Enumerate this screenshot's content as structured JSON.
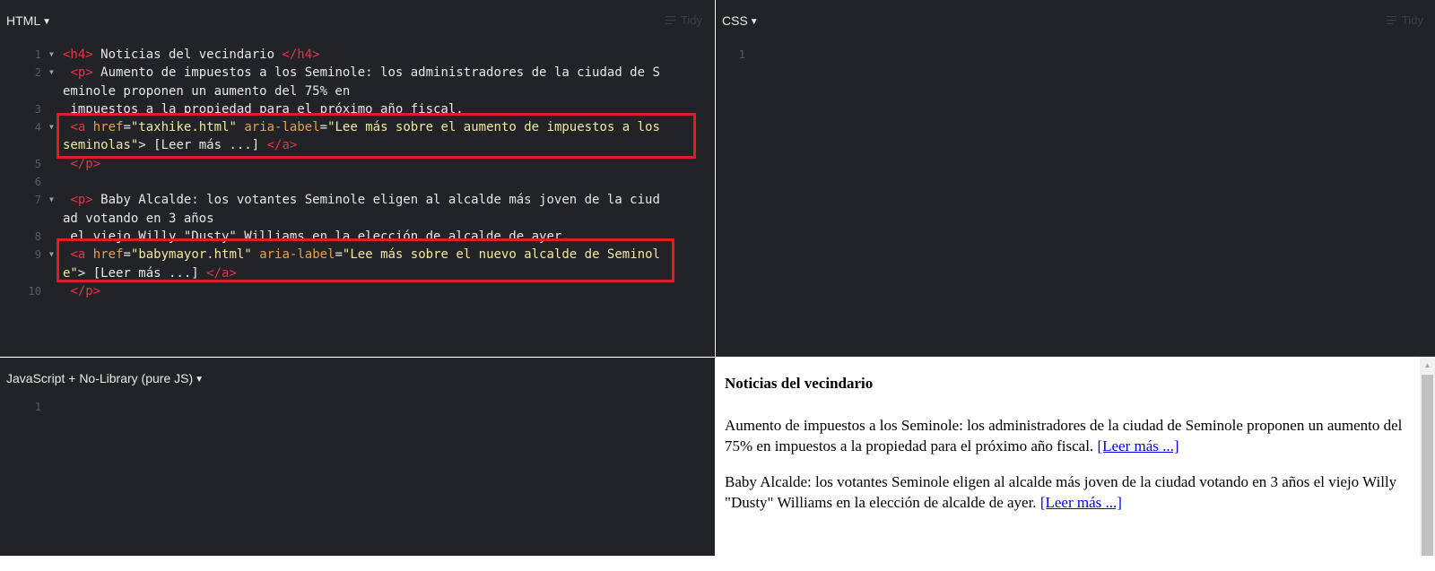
{
  "html_panel": {
    "title": "HTML",
    "tidy_label": "Tidy",
    "lines": [
      {
        "num": "1",
        "fold": true,
        "parts": [
          [
            "t",
            "<h4>"
          ],
          [
            "x",
            " Noticias del vecindario "
          ],
          [
            "t",
            "</h4>"
          ]
        ]
      },
      {
        "num": "2",
        "fold": true,
        "parts": [
          [
            "x",
            " "
          ],
          [
            "t",
            "<p>"
          ],
          [
            "x",
            " Aumento de impuestos a los Seminole: los administradores de la ciudad de S"
          ]
        ]
      },
      {
        "num": "",
        "fold": false,
        "parts": [
          [
            "x",
            "eminole proponen un aumento del 75% en"
          ]
        ]
      },
      {
        "num": "3",
        "fold": false,
        "parts": [
          [
            "x",
            " impuestos a la propiedad para el próximo año fiscal."
          ]
        ]
      },
      {
        "num": "4",
        "fold": true,
        "parts": [
          [
            "x",
            " "
          ],
          [
            "t",
            "<a"
          ],
          [
            "x",
            " "
          ],
          [
            "at",
            "href"
          ],
          [
            "x",
            "="
          ],
          [
            "s",
            "\"taxhike.html\""
          ],
          [
            "x",
            " "
          ],
          [
            "at",
            "aria-label"
          ],
          [
            "x",
            "="
          ],
          [
            "s",
            "\"Lee más sobre el aumento de impuestos a los"
          ]
        ]
      },
      {
        "num": "",
        "fold": false,
        "parts": [
          [
            "s",
            "seminolas\""
          ],
          [
            "x",
            "> [Leer más ...] "
          ],
          [
            "t",
            "</a>"
          ]
        ]
      },
      {
        "num": "5",
        "fold": false,
        "parts": [
          [
            "x",
            " "
          ],
          [
            "t",
            "</p>"
          ]
        ]
      },
      {
        "num": "6",
        "fold": false,
        "parts": []
      },
      {
        "num": "7",
        "fold": true,
        "parts": [
          [
            "x",
            " "
          ],
          [
            "t",
            "<p>"
          ],
          [
            "x",
            " Baby Alcalde: los votantes Seminole eligen al alcalde más joven de la ciud"
          ]
        ]
      },
      {
        "num": "",
        "fold": false,
        "parts": [
          [
            "x",
            "ad votando en 3 años"
          ]
        ]
      },
      {
        "num": "8",
        "fold": false,
        "parts": [
          [
            "x",
            " el viejo Willy \"Dusty\" Williams en la elección de alcalde de ayer."
          ]
        ]
      },
      {
        "num": "9",
        "fold": true,
        "parts": [
          [
            "x",
            " "
          ],
          [
            "t",
            "<a"
          ],
          [
            "x",
            " "
          ],
          [
            "at",
            "href"
          ],
          [
            "x",
            "="
          ],
          [
            "s",
            "\"babymayor.html\""
          ],
          [
            "x",
            " "
          ],
          [
            "at",
            "aria-label"
          ],
          [
            "x",
            "="
          ],
          [
            "s",
            "\"Lee más sobre el nuevo alcalde de Seminol"
          ]
        ]
      },
      {
        "num": "",
        "fold": false,
        "parts": [
          [
            "s",
            "e\""
          ],
          [
            "x",
            "> [Leer más ...] "
          ],
          [
            "t",
            "</a>"
          ]
        ]
      },
      {
        "num": "10",
        "fold": false,
        "parts": [
          [
            "x",
            " "
          ],
          [
            "t",
            "</p>"
          ]
        ]
      }
    ]
  },
  "css_panel": {
    "title": "CSS",
    "tidy_label": "Tidy",
    "lines": [
      {
        "num": "1",
        "fold": false,
        "parts": []
      }
    ]
  },
  "js_panel": {
    "title": "JavaScript + No-Library (pure JS)",
    "lines": [
      {
        "num": "1",
        "fold": false,
        "parts": []
      }
    ]
  },
  "result": {
    "heading": "Noticias del vecindario",
    "p1_text": "Aumento de impuestos a los Seminole: los administradores de la ciudad de Seminole proponen un aumento del 75% en impuestos a la propiedad para el próximo año fiscal. ",
    "p1_link": "[Leer más ...]",
    "p2_text": "Baby Alcalde: los votantes Seminole eligen al alcalde más joven de la ciudad votando en 3 años el viejo Willy \"Dusty\" Williams en la elección de alcalde de ayer. ",
    "p2_link": "[Leer más ...]"
  },
  "colors": {
    "editor_bg": "#222326",
    "tag": "#e8314d",
    "attribute": "#e3a24a",
    "string": "#f2e9a0",
    "highlight_box": "#dd1e28",
    "link": "#0000ee"
  }
}
